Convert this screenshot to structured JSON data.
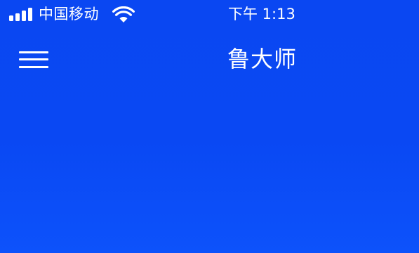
{
  "status_bar": {
    "carrier": "中国移动",
    "time": "下午 1:13",
    "signal_icon": "cellular-signal-icon",
    "wifi_icon": "wifi-icon"
  },
  "nav": {
    "title": "鲁大师",
    "menu_icon": "hamburger-menu-icon"
  },
  "colors": {
    "background": "#0a48f3",
    "foreground": "#ffffff"
  }
}
